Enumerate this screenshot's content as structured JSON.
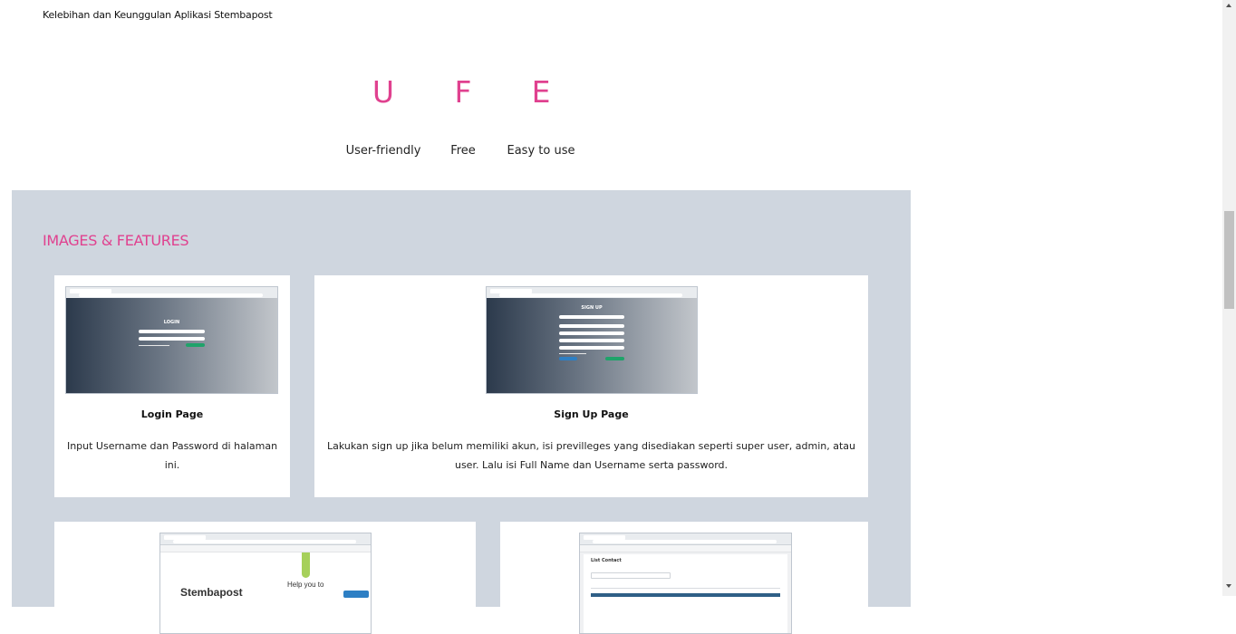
{
  "page": {
    "heading": "Kelebihan dan Keunggulan Aplikasi Stembapost"
  },
  "advantages": [
    {
      "letter": "U",
      "label": "User-friendly"
    },
    {
      "letter": "F",
      "label": "Free"
    },
    {
      "letter": "E",
      "label": "Easy to use"
    }
  ],
  "features": {
    "title": "IMAGES & FEATURES",
    "cards": [
      {
        "title": "Login Page",
        "description": "Input Username dan Password di halaman ini.",
        "thumb_caption": "LOGIN"
      },
      {
        "title": "Sign Up Page",
        "description": "Lakukan sign up jika belum memiliki akun, isi previlleges yang disediakan seperti super user, admin, atau user. Lalu isi Full Name dan Username serta password.",
        "thumb_caption": "SIGN UP"
      },
      {
        "thumb_caption": "Stembapost",
        "thumb_subcaption": "Help you to"
      },
      {
        "thumb_caption": "List Contact"
      }
    ]
  },
  "colors": {
    "accent": "#e0418f",
    "section_bg": "#cfd6df"
  }
}
